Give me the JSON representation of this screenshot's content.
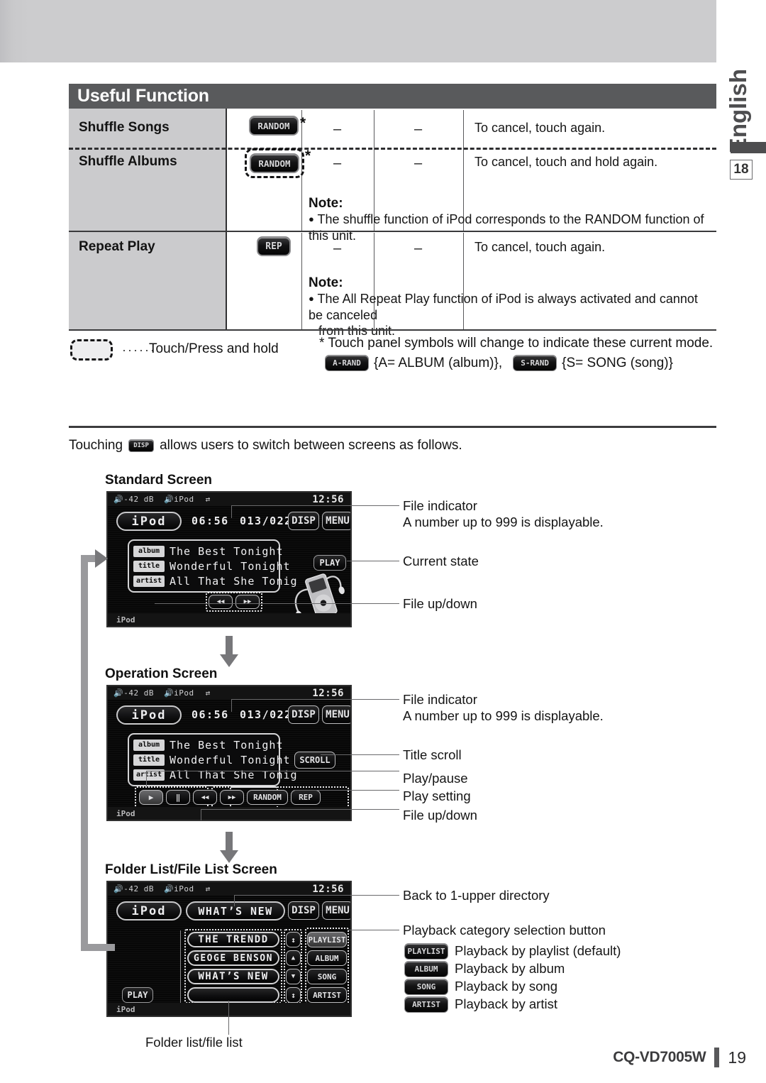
{
  "page": {
    "section_title": "Useful Function",
    "language_tab": "English",
    "chapter_number": "18",
    "model": "CQ-VD7005W",
    "page_number": "19"
  },
  "table": {
    "rows": [
      {
        "label": "Shuffle Songs",
        "button": "RANDOM",
        "hold": false,
        "star": "*",
        "col2": "–",
        "col3": "–",
        "description": "To cancel, touch again."
      },
      {
        "label": "Shuffle Albums",
        "button": "RANDOM",
        "hold": true,
        "star": "*",
        "col2": "–",
        "col3": "–",
        "description": "To cancel, touch and hold again."
      },
      {
        "label": "Repeat Play",
        "button": "REP",
        "hold": false,
        "star": "",
        "col2": "–",
        "col3": "–",
        "description": "To cancel, touch again."
      }
    ],
    "note1_head": "Note:",
    "note1_body": "The shuffle function of iPod corresponds to the RANDOM function of this unit.",
    "note2_head": "Note:",
    "note2_body_line1": "The All Repeat Play function of iPod is always activated and cannot be canceled",
    "note2_body_line2": "from this unit."
  },
  "legend": {
    "dots": "······",
    "hold_text": "Touch/Press and hold",
    "star_note": "* Touch panel symbols will change to indicate these current mode.",
    "a_rand_button": "A-RAND",
    "a_rand_text": "{A= ALBUM (album)},",
    "s_rand_button": "S-RAND",
    "s_rand_text": "{S= SONG (song)}"
  },
  "intro": {
    "before": "Touching",
    "disp_button": "DISP",
    "after": "allows users to switch between screens as follows."
  },
  "screens": [
    {
      "caption": "Standard Screen",
      "statusbar": {
        "volume": "-42 dB",
        "source": "iPod",
        "symbol": "⇄",
        "clock": "12:56"
      },
      "source_pill": "iPod",
      "time": "06:56",
      "file_indicator": "013/022",
      "disp": "DISP",
      "menu": "MENU",
      "info": [
        {
          "tag": "album",
          "value": "The Best  Tonight"
        },
        {
          "tag": "title",
          "value": "Wonderful Tonight"
        },
        {
          "tag": "artist",
          "value": "All That She Tonig"
        }
      ],
      "state_badge": "PLAY",
      "transport": [
        "◀◀",
        "▶▶"
      ],
      "footer": "iPod",
      "annotations": [
        "File indicator",
        "A number up to 999 is displayable.",
        "Current state",
        "File up/down"
      ]
    },
    {
      "caption": "Operation Screen",
      "statusbar": {
        "volume": "-42 dB",
        "source": "iPod",
        "symbol": "⇄",
        "clock": "12:56"
      },
      "source_pill": "iPod",
      "time": "06:56",
      "file_indicator": "013/022",
      "disp": "DISP",
      "menu": "MENU",
      "info": [
        {
          "tag": "album",
          "value": "The Best  Tonight"
        },
        {
          "tag": "title",
          "value": "Wonderful Tonight"
        },
        {
          "tag": "artist",
          "value": "All That She Tonig"
        }
      ],
      "scroll_badge": "SCROLL",
      "controls": [
        "▶",
        "‖",
        "◀◀",
        "▶▶",
        "RANDOM",
        "REP"
      ],
      "footer": "iPod",
      "annotations": [
        "File indicator",
        "A number up to 999 is displayable.",
        "Title scroll",
        "Play/pause",
        "Play setting",
        "File up/down"
      ]
    },
    {
      "caption": "Folder List/File List Screen",
      "statusbar": {
        "volume": "-42 dB",
        "source": "iPod",
        "symbol": "⇄",
        "clock": "12:56"
      },
      "source_pill": "iPod",
      "title_pill": "WHAT’S NEW",
      "disp": "DISP",
      "menu": "MENU",
      "list": [
        "THE TRENDD",
        "GEOGE BENSON",
        "WHAT’S NEW",
        ""
      ],
      "scroll_keys": [
        "↕",
        "▲",
        "▼",
        "↕"
      ],
      "categories": [
        "PLAYLIST",
        "ALBUM",
        "SONG",
        "ARTIST"
      ],
      "play_badge": "PLAY",
      "footer": "iPod",
      "bottom_label": "Folder list/file list",
      "annotations": [
        "Back to 1-upper directory",
        "Playback category selection button"
      ],
      "category_legend": [
        {
          "button": "PLAYLIST",
          "label": "Playback by playlist (default)"
        },
        {
          "button": "ALBUM",
          "label": "Playback by album"
        },
        {
          "button": "SONG",
          "label": "Playback by song"
        },
        {
          "button": "ARTIST",
          "label": "Playback by artist"
        }
      ]
    }
  ]
}
